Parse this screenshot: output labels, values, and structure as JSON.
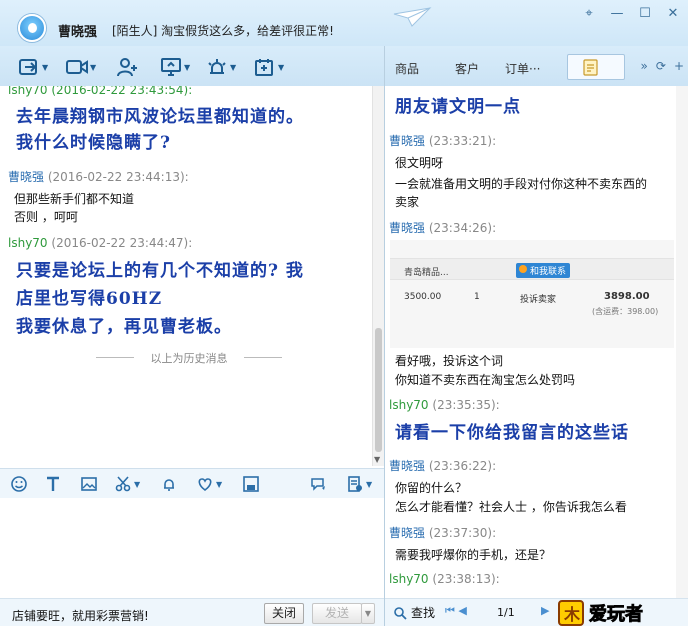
{
  "window": {
    "contact_name": "曹晓强",
    "status": "[陌生人] 淘宝假货这么多，给差评很正常!"
  },
  "right_tabs": [
    "商品",
    "客户",
    "订单···"
  ],
  "left_chat": {
    "top_partial": "lshy70 (2016-02-22 23:43:54):",
    "big1_line1": "去年晨翔钢市风波论坛里都知道的。",
    "big1_line2": "我什么时候隐瞒了?",
    "m2_name": "曹晓强",
    "m2_time": "(2016-02-22 23:44:13):",
    "m2_line1": "但那些新手们都不知道",
    "m2_line2": "否则 ，呵呵",
    "m3_name": "lshy70",
    "m3_time": "(2016-02-22 23:44:47):",
    "big3_line1": "只要是论坛上的有几个不知道的? 我",
    "big3_line2": "店里也写得60HZ",
    "big3_line3": "我要休息了，再见曹老板。",
    "history_label": "以上为历史消息"
  },
  "right_chat": {
    "big1": "朋友请文明一点",
    "r1_name": "曹晓强",
    "r1_time": "(23:33:21):",
    "r1_line1": "很文明呀",
    "r1_line2": "一会就准备用文明的手段对付你这种不卖东西的",
    "r1_line3": "卖家",
    "r2_name": "曹晓强",
    "r2_time": "(23:34:26):",
    "order": {
      "shop": "青岛精品...",
      "contact": "和我联系",
      "price": "3500.00",
      "qty": "1",
      "action": "投诉卖家",
      "total": "3898.00",
      "shipping": "(含运费：398.00)"
    },
    "r2_line1": "看好哦，投诉这个词",
    "r2_line2": "你知道不卖东西在淘宝怎么处罚吗",
    "r3_name": "lshy70",
    "r3_time": "(23:35:35):",
    "big3": "请看一下你给我留言的这些话",
    "r4_name": "曹晓强",
    "r4_time": "(23:36:22):",
    "r4_line1": "你留的什么？",
    "r4_line2": "怎么才能看懂？社会人士 ，你告诉我怎么看",
    "r5_name": "曹晓强",
    "r5_time": "(23:37:30):",
    "r5_line1": "需要我呼爆你的手机，还是？",
    "r6_name": "lshy70",
    "r6_time": "(23:38:13):"
  },
  "bottom": {
    "ad_text": "店铺要旺，就用彩票营销!",
    "close_label": "关闭",
    "send_label": "发送",
    "find_label": "查找",
    "page": "1/1",
    "logo_text": "爱玩者"
  }
}
